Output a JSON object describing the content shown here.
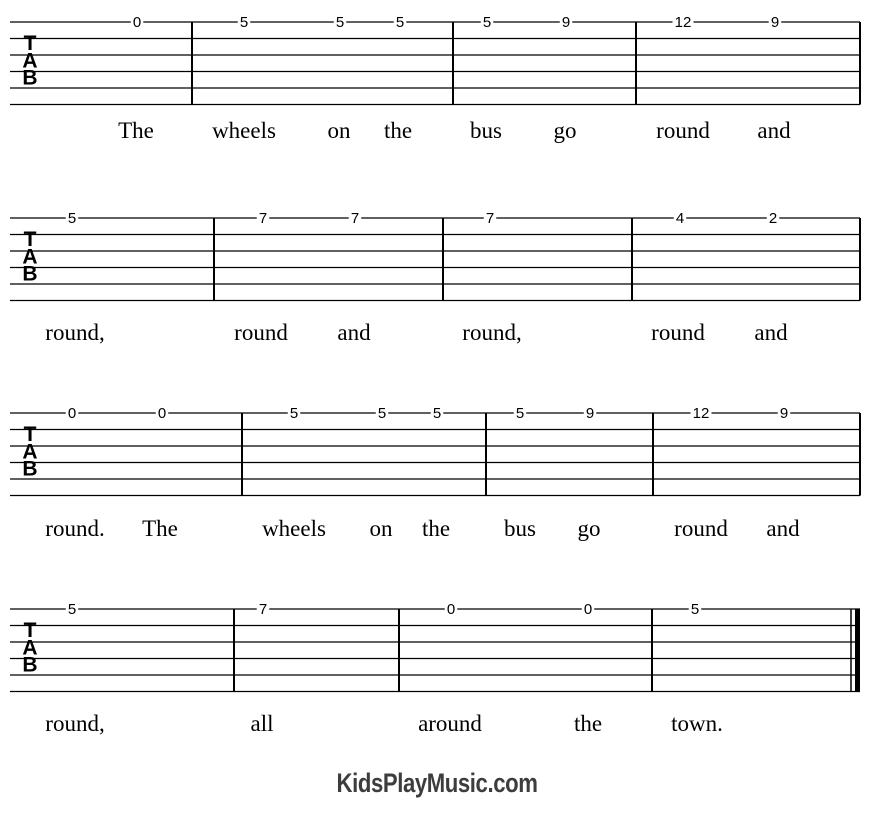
{
  "clef_label": [
    "T",
    "A",
    "B"
  ],
  "systems": [
    {
      "measures": [
        [
          "0"
        ],
        [
          "5",
          "5",
          "5"
        ],
        [
          "5",
          "9"
        ],
        [
          "12",
          "9"
        ]
      ],
      "lyrics": [
        "The",
        "wheels",
        "on",
        "the",
        "bus",
        "go",
        "round",
        "and"
      ]
    },
    {
      "measures": [
        [
          "5"
        ],
        [
          "7",
          "7"
        ],
        [
          "7"
        ],
        [
          "4",
          "2"
        ]
      ],
      "lyrics": [
        "round,",
        "round",
        "and",
        "round,",
        "round",
        "and"
      ]
    },
    {
      "measures": [
        [
          "0",
          "0"
        ],
        [
          "5",
          "5",
          "5"
        ],
        [
          "5",
          "9"
        ],
        [
          "12",
          "9"
        ]
      ],
      "lyrics": [
        "round.",
        "The",
        "wheels",
        "on",
        "the",
        "bus",
        "go",
        "round",
        "and"
      ]
    },
    {
      "measures": [
        [
          "5"
        ],
        [
          "7"
        ],
        [
          "0",
          "0"
        ],
        [
          "5"
        ]
      ],
      "lyrics": [
        "round,",
        "all",
        "around",
        "the",
        "town."
      ],
      "final_barline": true
    }
  ],
  "footer": {
    "brand": "KidsPlayMusic.com"
  }
}
